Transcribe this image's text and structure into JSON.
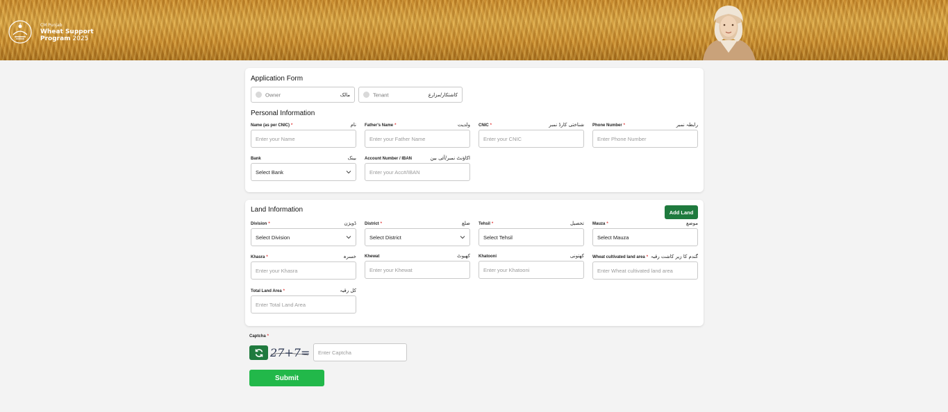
{
  "header": {
    "kicker": "CM Punjab",
    "line1": "Wheat Support",
    "line2_bold": "Program",
    "line2_year": "2025"
  },
  "application": {
    "title": "Application Form",
    "owner": {
      "en": "Owner",
      "ur": "مالک"
    },
    "tenant": {
      "en": "Tenant",
      "ur": "کاشتکار/مزارع"
    },
    "personal_title": "Personal Information",
    "fields": {
      "name": {
        "label": "Name (as per CNIC)",
        "req": "*",
        "ur": "نام",
        "placeholder": "Enter your  Name"
      },
      "father": {
        "label": "Father's Name",
        "req": "*",
        "ur": "ولدیت",
        "placeholder": "Enter your Father Name"
      },
      "cnic": {
        "label": "CNIC",
        "req": "*",
        "ur": "شناختی کارڈ نمبر",
        "placeholder": "Enter your CNIC"
      },
      "phone": {
        "label": "Phone Number",
        "req": "*",
        "ur": "رابطہ نمبر",
        "placeholder": "Enter Phone Number"
      },
      "bank": {
        "label": "Bank",
        "ur": "بینک",
        "value": "Select Bank"
      },
      "account": {
        "label": "Account Number / IBAN",
        "ur": "اکاؤنٹ نمبر/آئی بین",
        "placeholder": "Enter your Acc#/IBAN"
      }
    }
  },
  "land": {
    "title": "Land Information",
    "add_label": "Add Land",
    "fields": {
      "division": {
        "label": "Division",
        "req": "*",
        "ur": "ڈویژن",
        "value": "Select Division"
      },
      "district": {
        "label": "District",
        "req": "*",
        "ur": "ضلع",
        "value": "Select District"
      },
      "tehsil": {
        "label": "Tehsil",
        "req": "*",
        "ur": "تحصیل",
        "value": "Select Tehsil"
      },
      "mauza": {
        "label": "Mauza",
        "req": "*",
        "ur": "موضع",
        "value": "Select Mauza"
      },
      "khasra": {
        "label": "Khasra",
        "req": "*",
        "ur": "خسرہ",
        "placeholder": "Enter your Khasra"
      },
      "khewat": {
        "label": "Khewat",
        "ur": "کھیوٹ",
        "placeholder": "Enter your Khewat"
      },
      "khatooni": {
        "label": "Khatooni",
        "ur": "کھتونی",
        "placeholder": "Enter your Khatooni"
      },
      "wheat_area": {
        "label": "Wheat cultivated land area",
        "req": "*",
        "ur": "گندم کا زیر کاشت رقبہ",
        "placeholder": "Enter Wheat cultivated land area"
      },
      "total_area": {
        "label": "Total Land Area",
        "req": "*",
        "ur": "کل رقبہ",
        "placeholder": "Enter Total Land Area"
      }
    }
  },
  "captcha": {
    "label": "Captcha",
    "req": "*",
    "image_text": "27+7=",
    "placeholder": "Enter Captcha"
  },
  "submit_label": "Submit",
  "colors": {
    "primary_green": "#1f7a3e",
    "submit_green": "#22b84a",
    "required_red": "#e03a3a"
  }
}
